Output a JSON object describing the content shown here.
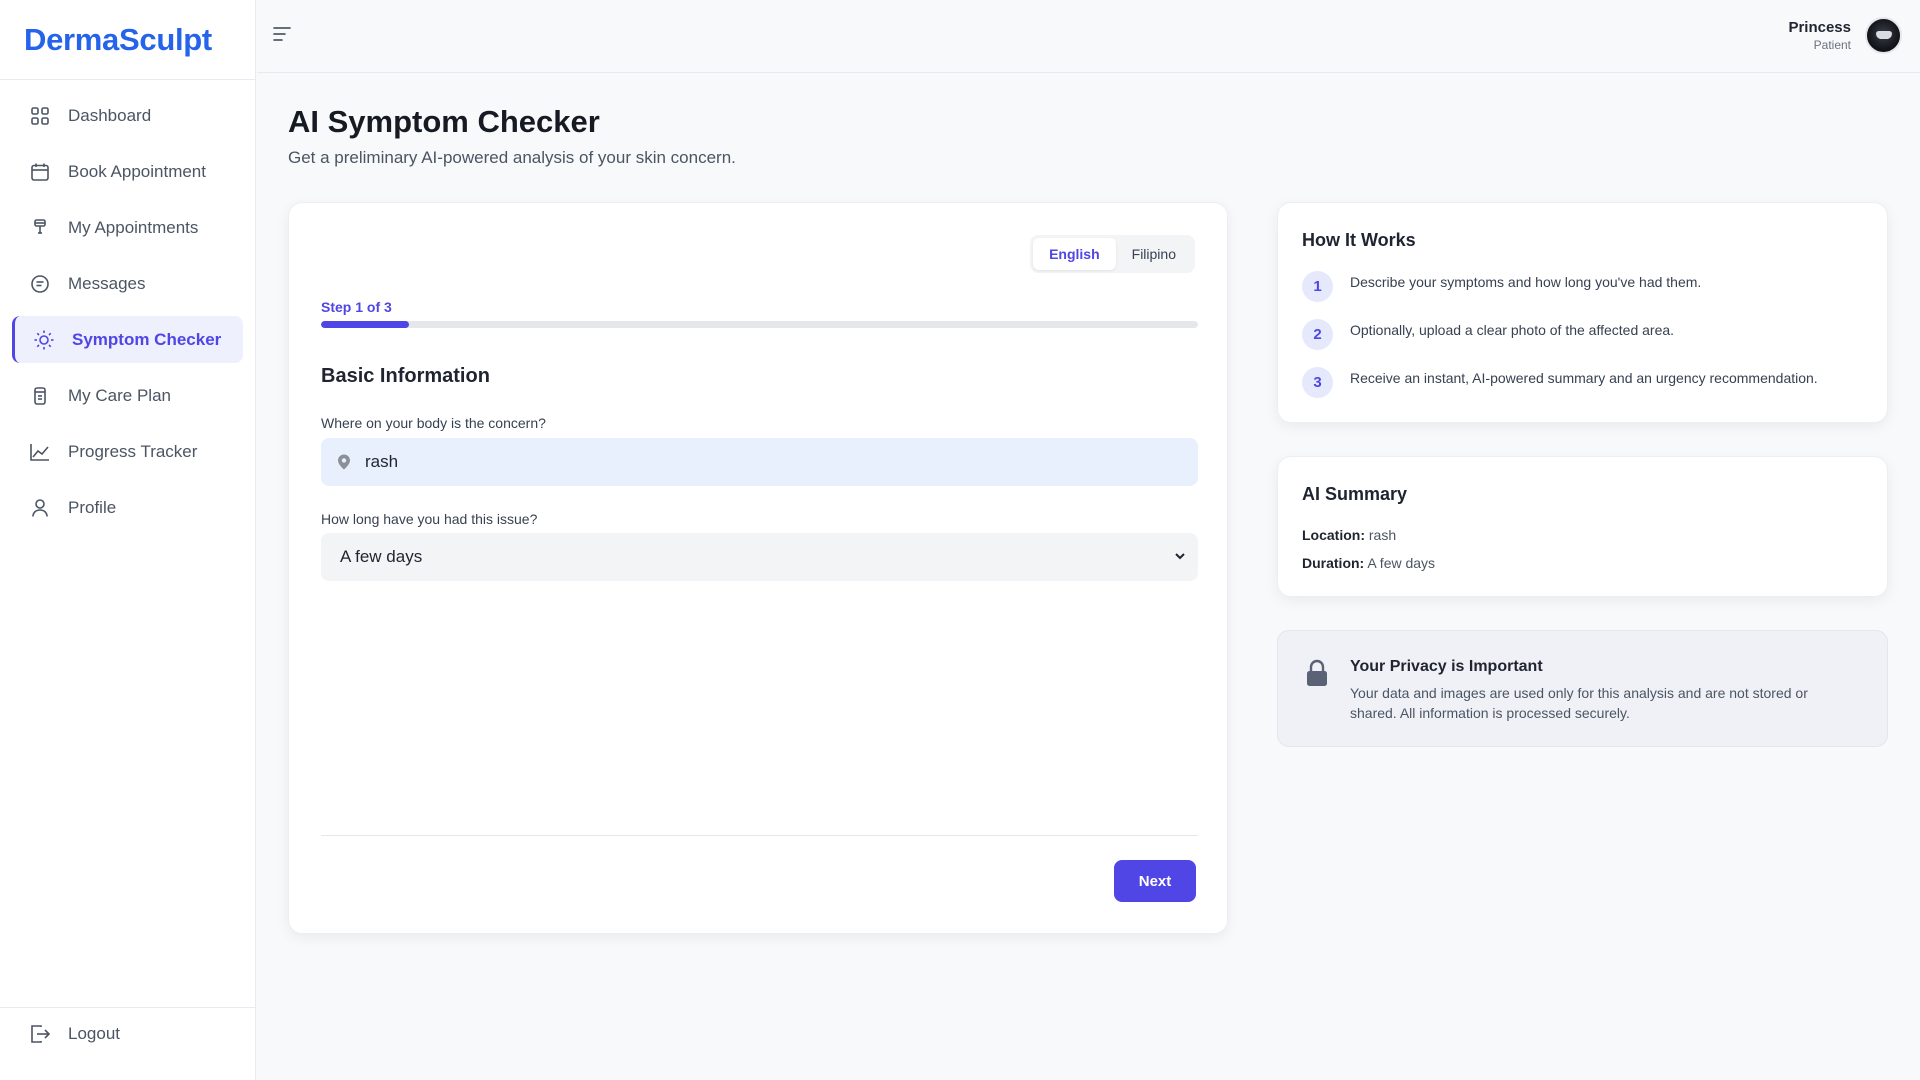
{
  "brand": "DermaSculpt",
  "sidebar": {
    "items": [
      {
        "label": "Dashboard",
        "icon": "grid-icon"
      },
      {
        "label": "Book Appointment",
        "icon": "calendar-icon"
      },
      {
        "label": "My Appointments",
        "icon": "pill-icon"
      },
      {
        "label": "Messages",
        "icon": "message-icon"
      },
      {
        "label": "Symptom Checker",
        "icon": "sun-icon",
        "active": true
      },
      {
        "label": "My Care Plan",
        "icon": "clipboard-icon"
      },
      {
        "label": "Progress Tracker",
        "icon": "chart-line-icon"
      },
      {
        "label": "Profile",
        "icon": "user-icon"
      }
    ],
    "logout_label": "Logout"
  },
  "user": {
    "name": "Princess",
    "role": "Patient"
  },
  "page": {
    "title": "AI Symptom Checker",
    "subtitle": "Get a preliminary AI-powered analysis of your skin concern."
  },
  "form": {
    "languages": [
      "English",
      "Filipino"
    ],
    "active_language": "English",
    "step_label": "Step 1 of 3",
    "progress_fraction": 0.1,
    "section_title": "Basic Information",
    "location_label": "Where on your body is the concern?",
    "location_value": "rash",
    "duration_label": "How long have you had this issue?",
    "duration_value": "A few days",
    "next_label": "Next"
  },
  "how_it_works": {
    "title": "How It Works",
    "steps": [
      {
        "num": "1",
        "text": "Describe your symptoms and how long you've had them."
      },
      {
        "num": "2",
        "text": "Optionally, upload a clear photo of the affected area."
      },
      {
        "num": "3",
        "text": "Receive an instant, AI-powered summary and an urgency recommendation."
      }
    ]
  },
  "summary": {
    "title": "AI Summary",
    "location_key": "Location:",
    "location_value": "rash",
    "duration_key": "Duration:",
    "duration_value": "A few days"
  },
  "privacy": {
    "title": "Your Privacy is Important",
    "text": "Your data and images are used only for this analysis and are not stored or shared. All information is processed securely."
  },
  "colors": {
    "brand": "#2563eb",
    "accent": "#4f46e5"
  }
}
